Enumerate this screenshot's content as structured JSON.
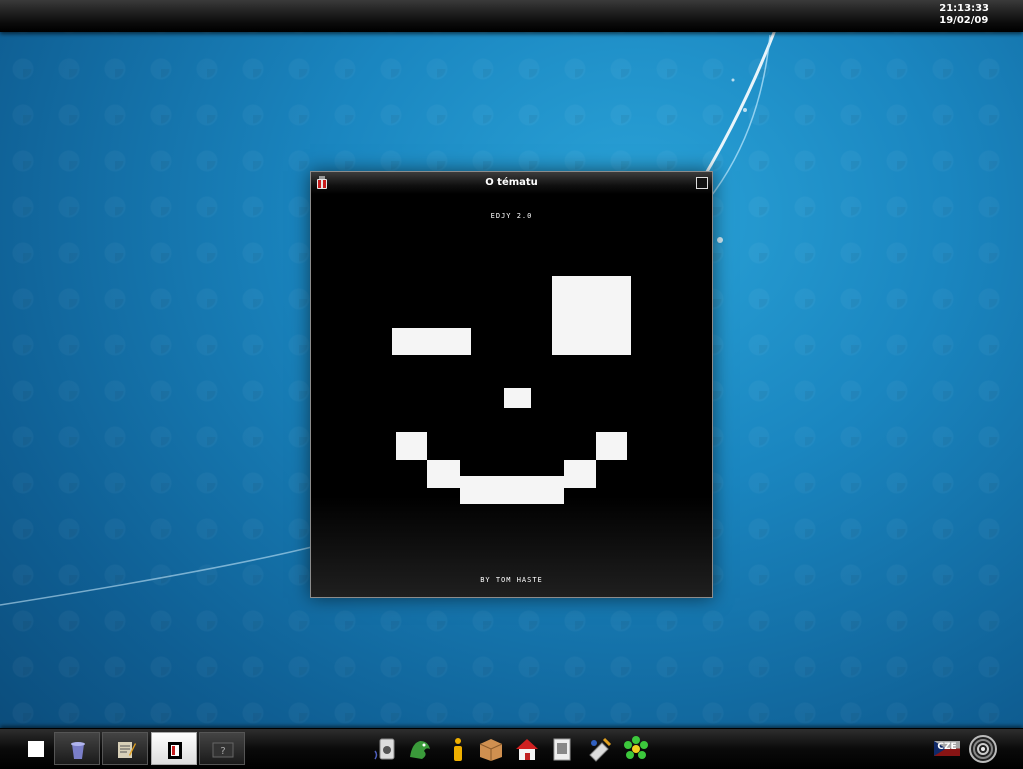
{
  "clock": {
    "time": "21:13:33",
    "date": "19/02/09"
  },
  "window": {
    "title": "O tématu",
    "theme_name": "EDJY 2.0",
    "theme_author": "BY TOM HASTE"
  },
  "taskbar": {
    "tasks": [
      {
        "name": "trash-icon",
        "active": false
      },
      {
        "name": "text-editor-icon",
        "active": false
      },
      {
        "name": "theme-paint-icon",
        "active": true
      },
      {
        "name": "help-icon",
        "active": false
      }
    ],
    "launchers": [
      "speaker-app-icon",
      "dragon-app-icon",
      "info-app-icon",
      "package-app-icon",
      "home-folder-icon",
      "document-viewer-icon",
      "graphics-app-icon",
      "icq-flower-icon"
    ],
    "language": "CZE"
  },
  "colors": {
    "panel": "#000000",
    "desktop": "#1a86c0",
    "pixel": "#f5f5f5"
  }
}
